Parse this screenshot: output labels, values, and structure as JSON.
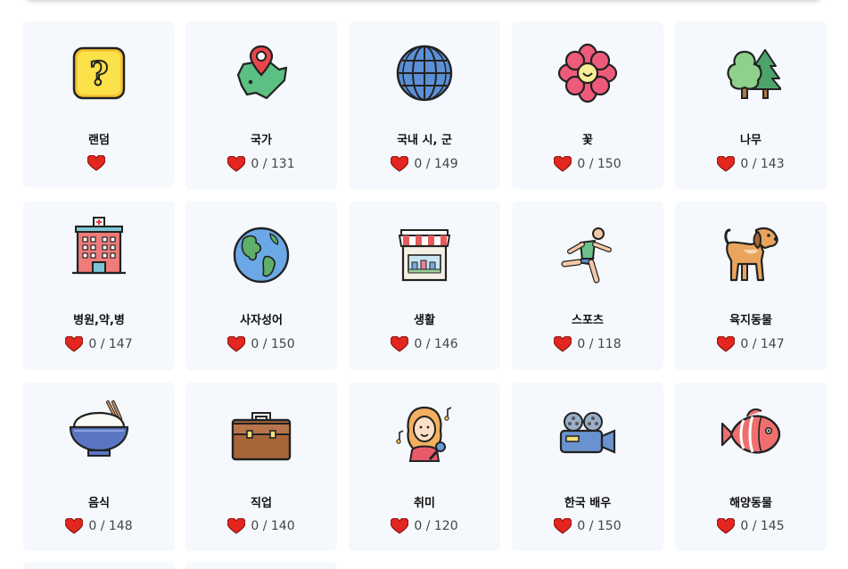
{
  "cards": [
    {
      "title": "랜덤",
      "count": "",
      "icon": "question-box-icon"
    },
    {
      "title": "국가",
      "count": "0 / 131",
      "icon": "country-map-pin-icon"
    },
    {
      "title": "국내 시, 군",
      "count": "0 / 149",
      "icon": "globe-grid-icon"
    },
    {
      "title": "꽃",
      "count": "0 / 150",
      "icon": "flower-icon"
    },
    {
      "title": "나무",
      "count": "0 / 143",
      "icon": "trees-icon"
    },
    {
      "title": "병원,약,병",
      "count": "0 / 147",
      "icon": "hospital-icon"
    },
    {
      "title": "사자성어",
      "count": "0 / 150",
      "icon": "earth-icon"
    },
    {
      "title": "생활",
      "count": "0 / 146",
      "icon": "store-icon"
    },
    {
      "title": "스포츠",
      "count": "0 / 118",
      "icon": "runner-icon"
    },
    {
      "title": "육지동물",
      "count": "0 / 147",
      "icon": "dog-icon"
    },
    {
      "title": "음식",
      "count": "0 / 148",
      "icon": "rice-bowl-icon"
    },
    {
      "title": "직업",
      "count": "0 / 140",
      "icon": "briefcase-icon"
    },
    {
      "title": "취미",
      "count": "0 / 120",
      "icon": "singer-icon"
    },
    {
      "title": "한국 배우",
      "count": "0 / 150",
      "icon": "film-camera-icon"
    },
    {
      "title": "해양동물",
      "count": "0 / 145",
      "icon": "fish-icon"
    }
  ],
  "colors": {
    "card_bg": "#f5f8fc",
    "heart": "#e3261f"
  }
}
